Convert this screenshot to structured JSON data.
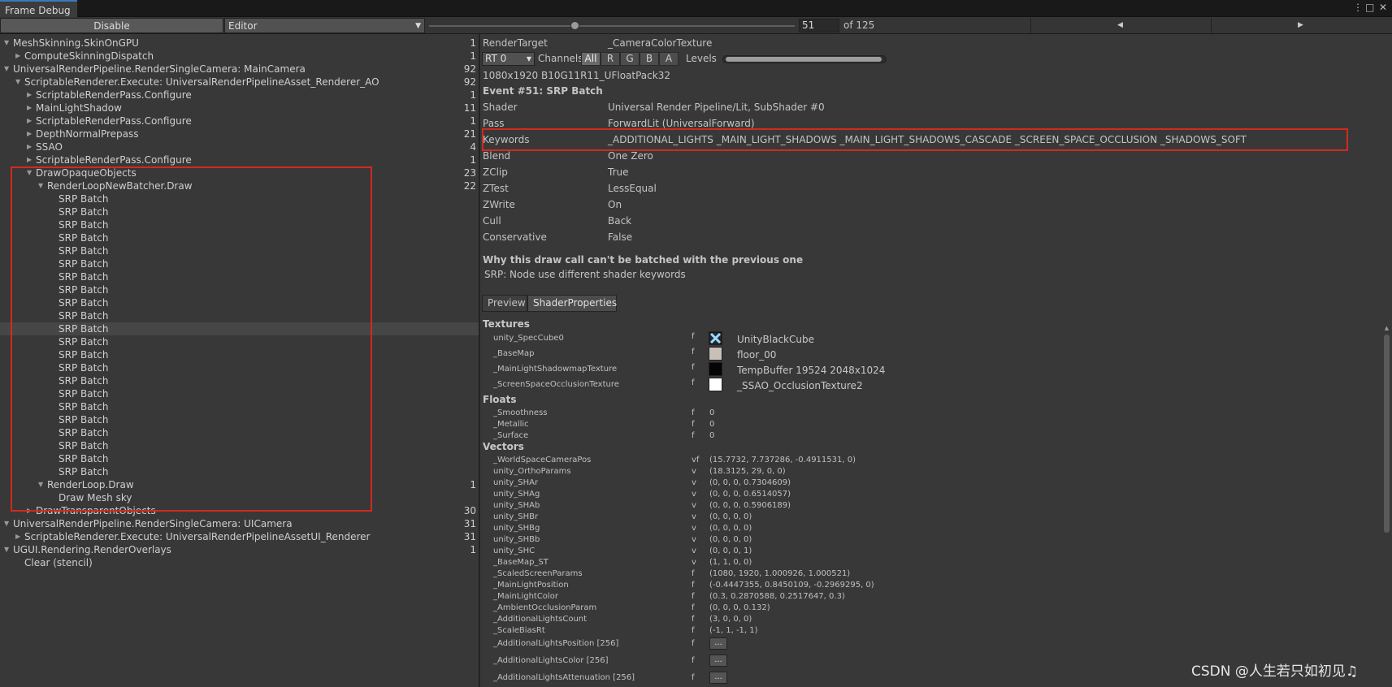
{
  "window": {
    "tab_title": "Frame Debug",
    "controls": [
      "⋮",
      "□",
      "✕"
    ]
  },
  "toolbar": {
    "disable_label": "Disable",
    "target_selected": "Editor",
    "frame_value": "51",
    "frame_of": "of 125",
    "slider_fraction": 0.4,
    "prev_glyph": "◀",
    "next_glyph": "▶"
  },
  "tree": [
    {
      "label": "MeshSkinning.SkinOnGPU",
      "count": "1",
      "depth": 0,
      "expand": "down"
    },
    {
      "label": "ComputeSkinningDispatch",
      "count": "1",
      "depth": 1,
      "expand": "right"
    },
    {
      "label": "UniversalRenderPipeline.RenderSingleCamera: MainCamera",
      "count": "92",
      "depth": 0,
      "expand": "down"
    },
    {
      "label": "ScriptableRenderer.Execute: UniversalRenderPipelineAsset_Renderer_AO",
      "count": "92",
      "depth": 1,
      "expand": "down"
    },
    {
      "label": "ScriptableRenderPass.Configure",
      "count": "1",
      "depth": 2,
      "expand": "right"
    },
    {
      "label": "MainLightShadow",
      "count": "11",
      "depth": 2,
      "expand": "right"
    },
    {
      "label": "ScriptableRenderPass.Configure",
      "count": "1",
      "depth": 2,
      "expand": "right"
    },
    {
      "label": "DepthNormalPrepass",
      "count": "21",
      "depth": 2,
      "expand": "right"
    },
    {
      "label": "SSAO",
      "count": "4",
      "depth": 2,
      "expand": "right"
    },
    {
      "label": "ScriptableRenderPass.Configure",
      "count": "1",
      "depth": 2,
      "expand": "right"
    },
    {
      "label": "DrawOpaqueObjects",
      "count": "23",
      "depth": 2,
      "expand": "down"
    },
    {
      "label": "RenderLoopNewBatcher.Draw",
      "count": "22",
      "depth": 3,
      "expand": "down"
    },
    {
      "label": "SRP Batch",
      "count": "",
      "depth": 4,
      "expand": ""
    },
    {
      "label": "SRP Batch",
      "count": "",
      "depth": 4,
      "expand": ""
    },
    {
      "label": "SRP Batch",
      "count": "",
      "depth": 4,
      "expand": ""
    },
    {
      "label": "SRP Batch",
      "count": "",
      "depth": 4,
      "expand": ""
    },
    {
      "label": "SRP Batch",
      "count": "",
      "depth": 4,
      "expand": ""
    },
    {
      "label": "SRP Batch",
      "count": "",
      "depth": 4,
      "expand": ""
    },
    {
      "label": "SRP Batch",
      "count": "",
      "depth": 4,
      "expand": ""
    },
    {
      "label": "SRP Batch",
      "count": "",
      "depth": 4,
      "expand": ""
    },
    {
      "label": "SRP Batch",
      "count": "",
      "depth": 4,
      "expand": ""
    },
    {
      "label": "SRP Batch",
      "count": "",
      "depth": 4,
      "expand": ""
    },
    {
      "label": "SRP Batch",
      "count": "",
      "depth": 4,
      "expand": "",
      "selected": true
    },
    {
      "label": "SRP Batch",
      "count": "",
      "depth": 4,
      "expand": ""
    },
    {
      "label": "SRP Batch",
      "count": "",
      "depth": 4,
      "expand": ""
    },
    {
      "label": "SRP Batch",
      "count": "",
      "depth": 4,
      "expand": ""
    },
    {
      "label": "SRP Batch",
      "count": "",
      "depth": 4,
      "expand": ""
    },
    {
      "label": "SRP Batch",
      "count": "",
      "depth": 4,
      "expand": ""
    },
    {
      "label": "SRP Batch",
      "count": "",
      "depth": 4,
      "expand": ""
    },
    {
      "label": "SRP Batch",
      "count": "",
      "depth": 4,
      "expand": ""
    },
    {
      "label": "SRP Batch",
      "count": "",
      "depth": 4,
      "expand": ""
    },
    {
      "label": "SRP Batch",
      "count": "",
      "depth": 4,
      "expand": ""
    },
    {
      "label": "SRP Batch",
      "count": "",
      "depth": 4,
      "expand": ""
    },
    {
      "label": "SRP Batch",
      "count": "",
      "depth": 4,
      "expand": ""
    },
    {
      "label": "RenderLoop.Draw",
      "count": "1",
      "depth": 3,
      "expand": "down"
    },
    {
      "label": "Draw Mesh sky",
      "count": "",
      "depth": 4,
      "expand": ""
    },
    {
      "label": "DrawTransparentObjects",
      "count": "30",
      "depth": 2,
      "expand": "right"
    },
    {
      "label": "UniversalRenderPipeline.RenderSingleCamera: UICamera",
      "count": "31",
      "depth": 0,
      "expand": "down"
    },
    {
      "label": "ScriptableRenderer.Execute: UniversalRenderPipelineAssetUI_Renderer",
      "count": "31",
      "depth": 1,
      "expand": "right"
    },
    {
      "label": "UGUI.Rendering.RenderOverlays",
      "count": "1",
      "depth": 0,
      "expand": "down"
    },
    {
      "label": "Clear (stencil)",
      "count": "",
      "depth": 1,
      "expand": ""
    }
  ],
  "details": {
    "render_target_key": "RenderTarget",
    "render_target_value": "_CameraColorTexture",
    "rt_selected": "RT 0",
    "channels_label": "Channels",
    "channels": [
      "All",
      "R",
      "G",
      "B",
      "A"
    ],
    "levels_label": "Levels",
    "format": "1080x1920 B10G11R11_UFloatPack32",
    "event_title": "Event #51: SRP Batch",
    "props": [
      {
        "k": "Shader",
        "v": "Universal Render Pipeline/Lit, SubShader #0"
      },
      {
        "k": "Pass",
        "v": "ForwardLit (UniversalForward)"
      },
      {
        "k": "Keywords",
        "v": "_ADDITIONAL_LIGHTS _MAIN_LIGHT_SHADOWS _MAIN_LIGHT_SHADOWS_CASCADE _SCREEN_SPACE_OCCLUSION _SHADOWS_SOFT"
      },
      {
        "k": "Blend",
        "v": "One Zero"
      },
      {
        "k": "ZClip",
        "v": "True"
      },
      {
        "k": "ZTest",
        "v": "LessEqual"
      },
      {
        "k": "ZWrite",
        "v": "On"
      },
      {
        "k": "Cull",
        "v": "Back"
      },
      {
        "k": "Conservative",
        "v": "False"
      }
    ],
    "batch_reason_title": "Why this draw call can't be batched with the previous one",
    "batch_reason": "SRP: Node use different shader keywords"
  },
  "sp_tabs": [
    "Preview",
    "ShaderProperties"
  ],
  "shader_props": {
    "textures_title": "Textures",
    "textures": [
      {
        "name": "unity_SpecCube0",
        "type": "f",
        "tex": "UnityBlackCube",
        "swatch": "cube"
      },
      {
        "name": "_BaseMap",
        "type": "f",
        "tex": "floor_00",
        "swatch": "#c8bfb8"
      },
      {
        "name": "_MainLightShadowmapTexture",
        "type": "f",
        "tex": "TempBuffer 19524 2048x1024",
        "swatch": "#050505"
      },
      {
        "name": "_ScreenSpaceOcclusionTexture",
        "type": "f",
        "tex": "_SSAO_OcclusionTexture2",
        "swatch": "#ffffff"
      }
    ],
    "floats_title": "Floats",
    "floats": [
      {
        "name": "_Smoothness",
        "type": "f",
        "value": "0"
      },
      {
        "name": "_Metallic",
        "type": "f",
        "value": "0"
      },
      {
        "name": "_Surface",
        "type": "f",
        "value": "0"
      }
    ],
    "vectors_title": "Vectors",
    "vectors": [
      {
        "name": "_WorldSpaceCameraPos",
        "type": "vf",
        "value": "(15.7732, 7.737286, -0.4911531, 0)"
      },
      {
        "name": "unity_OrthoParams",
        "type": "v",
        "value": "(18.3125, 29, 0, 0)"
      },
      {
        "name": "unity_SHAr",
        "type": "v",
        "value": "(0, 0, 0, 0.7304609)"
      },
      {
        "name": "unity_SHAg",
        "type": "v",
        "value": "(0, 0, 0, 0.6514057)"
      },
      {
        "name": "unity_SHAb",
        "type": "v",
        "value": "(0, 0, 0, 0.5906189)"
      },
      {
        "name": "unity_SHBr",
        "type": "v",
        "value": "(0, 0, 0, 0)"
      },
      {
        "name": "unity_SHBg",
        "type": "v",
        "value": "(0, 0, 0, 0)"
      },
      {
        "name": "unity_SHBb",
        "type": "v",
        "value": "(0, 0, 0, 0)"
      },
      {
        "name": "unity_SHC",
        "type": "v",
        "value": "(0, 0, 0, 1)"
      },
      {
        "name": "_BaseMap_ST",
        "type": "v",
        "value": "(1, 1, 0, 0)"
      },
      {
        "name": "_ScaledScreenParams",
        "type": "f",
        "value": "(1080, 1920, 1.000926, 1.000521)"
      },
      {
        "name": "_MainLightPosition",
        "type": "f",
        "value": "(-0.4447355, 0.8450109, -0.2969295, 0)"
      },
      {
        "name": "_MainLightColor",
        "type": "f",
        "value": "(0.3, 0.2870588, 0.2517647, 0.3)"
      },
      {
        "name": "_AmbientOcclusionParam",
        "type": "f",
        "value": "(0, 0, 0, 0.132)"
      },
      {
        "name": "_AdditionalLightsCount",
        "type": "f",
        "value": "(3, 0, 0, 0)"
      },
      {
        "name": "_ScaleBiasRt",
        "type": "f",
        "value": "(-1, 1, -1, 1)"
      }
    ],
    "arrays": [
      {
        "name": "_AdditionalLightsPosition [256]",
        "type": "f",
        "button": "..."
      },
      {
        "name": "_AdditionalLightsColor [256]",
        "type": "f",
        "button": "..."
      },
      {
        "name": "_AdditionalLightsAttenuation [256]",
        "type": "f",
        "button": "..."
      }
    ]
  },
  "watermark": "CSDN @人生若只如初见♫",
  "colors": {
    "highlight_box": "#d12a20",
    "accent": "#3a79bb"
  }
}
